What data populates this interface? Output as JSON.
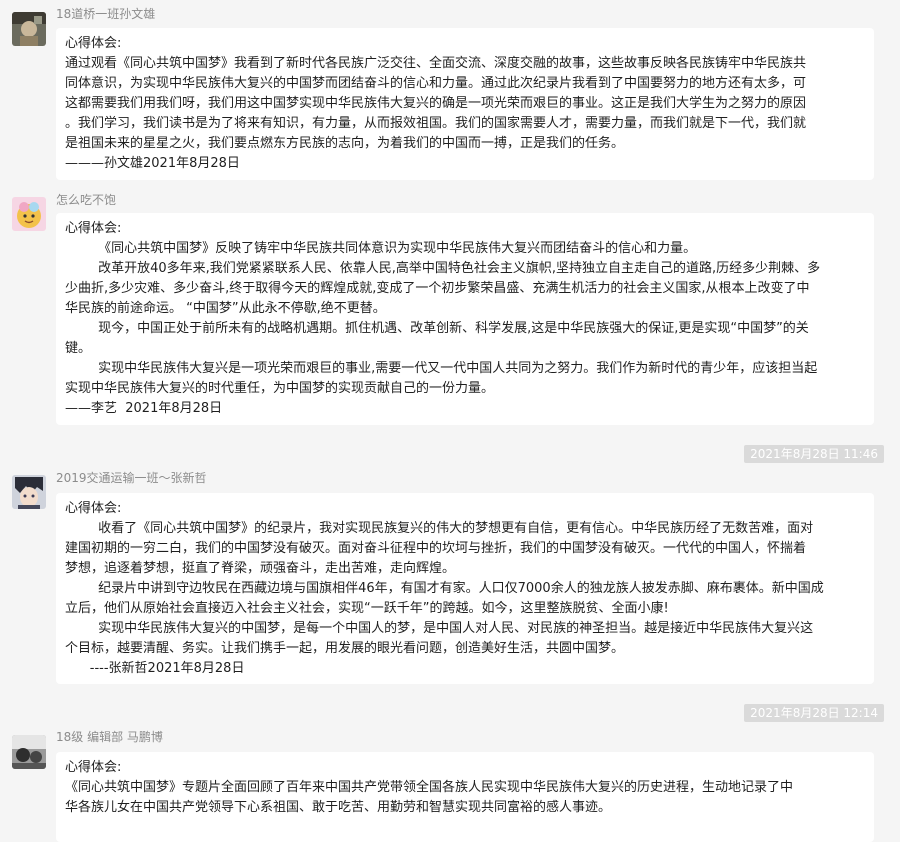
{
  "messages": [
    {
      "sender": "18道桥一班孙文雄",
      "lines": [
        "心得体会:",
        "通过观看《同心共筑中国梦》我看到了新时代各民族广泛交往、全面交流、深度交融的故事，这些故事反映各民族铸牢中华民族共",
        "同体意识，为实现中华民族伟大复兴的中国梦而团结奋斗的信心和力量。通过此次纪录片我看到了中国要努力的地方还有太多，可",
        "这都需要我们用我们呀，我们用这中国梦实现中华民族伟大复兴的确是一项光荣而艰巨的事业。这正是我们大学生为之努力的原因",
        "。我们学习，我们读书是为了将来有知识，有力量，从而报效祖国。我们的国家需要人才，需要力量，而我们就是下一代，我们就",
        "是祖国未来的星星之火，我们要点燃东方民族的志向，为着我们的中国而一搏，正是我们的任务。",
        "———孙文雄2021年8月28日"
      ]
    },
    {
      "sender": "怎么吃不饱",
      "lines": [
        "心得体会:",
        "        《同心共筑中国梦》反映了铸牢中华民族共同体意识为实现中华民族伟大复兴而团结奋斗的信心和力量。",
        "        改革开放40多年来,我们党紧紧联系人民、依靠人民,高举中国特色社会主义旗帜,坚持独立自主走自己的道路,历经多少荆棘、多",
        "少曲折,多少灾难、多少奋斗,终于取得今天的辉煌成就,变成了一个初步繁荣昌盛、充满生机活力的社会主义国家,从根本上改变了中",
        "华民族的前途命运。 “中国梦”从此永不停歇,绝不更替。",
        "        现今，中国正处于前所未有的战略机遇期。抓住机遇、改革创新、科学发展,这是中华民族强大的保证,更是实现“中国梦”的关",
        "键。",
        "        实现中华民族伟大复兴是一项光荣而艰巨的事业,需要一代又一代中国人共同为之努力。我们作为新时代的青少年，应该担当起",
        "实现中华民族伟大复兴的时代重任，为中国梦的实现贡献自己的一份力量。",
        "——李艺  2021年8月28日"
      ]
    },
    {
      "timestamp": "2021年8月28日 11:46",
      "sender": "2019交通运输一班～张新哲",
      "lines": [
        "心得体会:",
        "        收看了《同心共筑中国梦》的纪录片，我对实现民族复兴的伟大的梦想更有自信，更有信心。中华民族历经了无数苦难，面对",
        "建国初期的一穷二白，我们的中国梦没有破灭。面对奋斗征程中的坎坷与挫折，我们的中国梦没有破灭。一代代的中国人，怀揣着",
        "梦想，追逐着梦想，挺直了脊梁，顽强奋斗，走出苦难，走向辉煌。",
        "        纪录片中讲到守边牧民在西藏边境与国旗相伴46年，有国才有家。人口仅7000余人的独龙族人披发赤脚、麻布裹体。新中国成",
        "立后，他们从原始社会直接迈入社会主义社会，实现“一跃千年”的跨越。如今，这里整族脱贫、全面小康!",
        "        实现中华民族伟大复兴的中国梦，是每一个中国人的梦，是中国人对人民、对民族的神圣担当。越是接近中华民族伟大复兴这",
        "个目标，越要清醒、务实。让我们携手一起，用发展的眼光看问题，创造美好生活，共圆中国梦。",
        "      ----张新哲2021年8月28日"
      ]
    },
    {
      "timestamp": "2021年8月28日 12:14",
      "sender": "18级  编辑部  马鹏博",
      "lines": [
        "心得体会:",
        "《同心共筑中国梦》专题片全面回顾了百年来中国共产党带领全国各族人民实现中华民族伟大复兴的历史进程，生动地记录了中",
        "华各族儿女在中国共产党领导下心系祖国、敢于吃苦、用勤劳和智慧实现共同富裕的感人事迹。"
      ]
    }
  ],
  "icons": [
    "avatar-1",
    "avatar-2",
    "avatar-3",
    "avatar-4"
  ],
  "colors": {
    "background": "#f5f5f5",
    "bubble": "#ffffff",
    "timestamp_bg": "#dadada",
    "nickname": "#8c8c8c"
  }
}
